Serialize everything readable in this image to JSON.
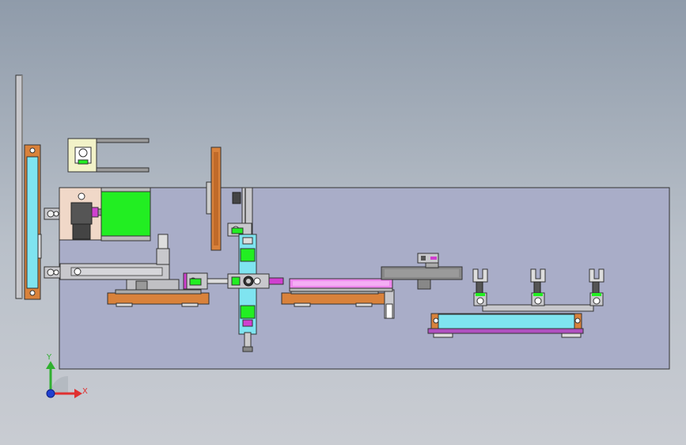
{
  "window": {
    "background_top": "#8f9baa",
    "background_bottom": "#c9ccd2"
  },
  "model": {
    "base_plate_color": "#a9adc8",
    "component_colors": {
      "frame": "#c8c8cc",
      "orange_bar": "#d9823b",
      "cyan_panel": "#7fe4f0",
      "green_block": "#22ee22",
      "pink_rail": "#ee88ee",
      "purple_strip": "#b050c0",
      "magenta": "#d040d0",
      "light_yellow": "#f2f2c8",
      "beige": "#f0d8c8",
      "dark_gray": "#555555"
    }
  },
  "triad": {
    "x_label": "X",
    "y_label": "Y",
    "x_color": "#e03030",
    "y_color": "#30b030",
    "z_color": "#2040d0"
  }
}
